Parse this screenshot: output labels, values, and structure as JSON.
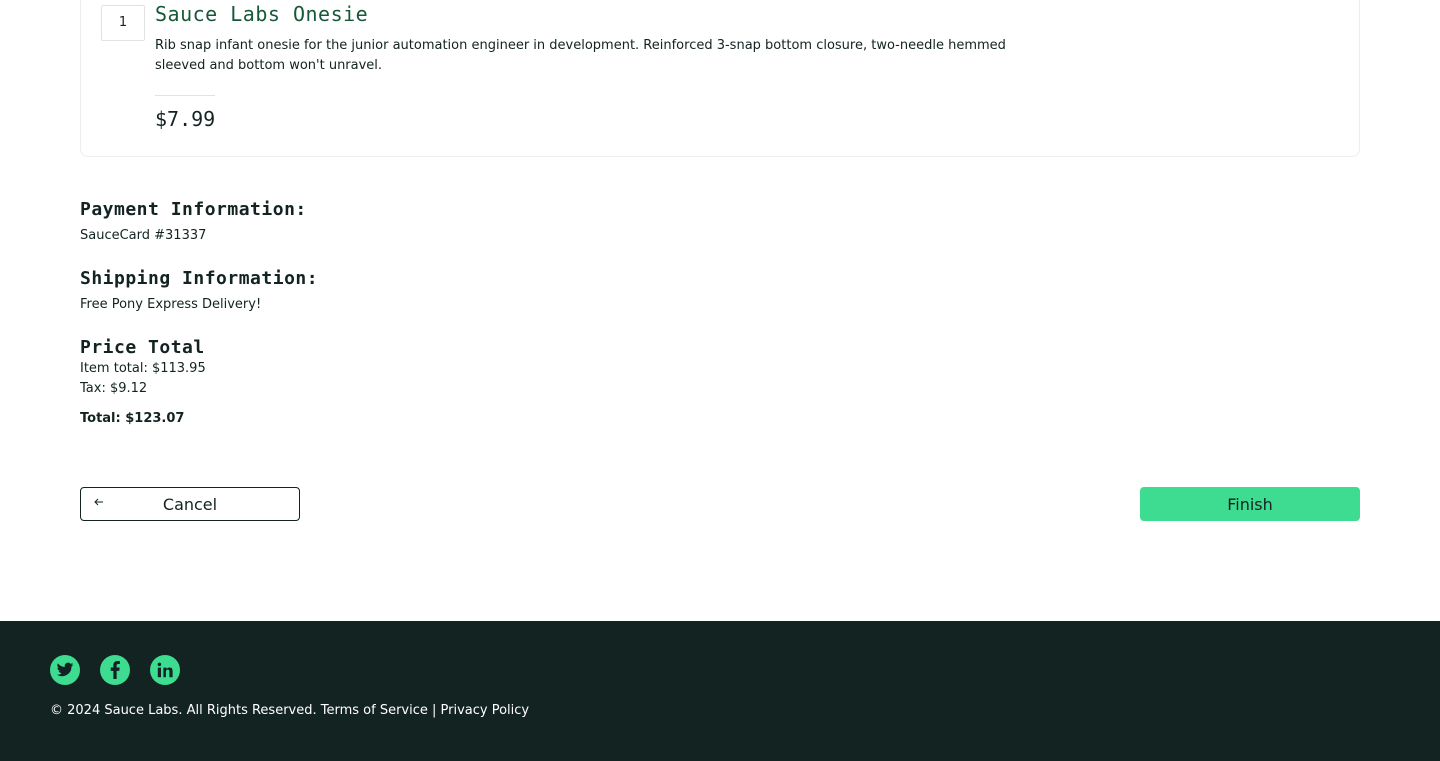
{
  "cart_item": {
    "quantity": "1",
    "name": "Sauce Labs Onesie",
    "description": "Rib snap infant onesie for the junior automation engineer in development. Reinforced 3-snap bottom closure, two-needle hemmed sleeved and bottom won't unravel.",
    "price": "$7.99"
  },
  "payment": {
    "heading": "Payment Information:",
    "value": "SauceCard #31337"
  },
  "shipping": {
    "heading": "Shipping Information:",
    "value": "Free Pony Express Delivery!"
  },
  "price_total": {
    "heading": "Price Total",
    "item_total": "Item total: $113.95",
    "tax": "Tax: $9.12",
    "total": "Total: $123.07"
  },
  "actions": {
    "cancel_label": "Cancel",
    "cancel_icon": "arrow-left-icon",
    "finish_label": "Finish"
  },
  "footer": {
    "social_icons": [
      "twitter-icon",
      "facebook-icon",
      "linkedin-icon"
    ],
    "copyright": "© 2024 Sauce Labs. All Rights Reserved. Terms of Service | Privacy Policy"
  },
  "colors": {
    "accent": "#3ddc91",
    "dark": "#132322",
    "item_title": "#18583a"
  }
}
